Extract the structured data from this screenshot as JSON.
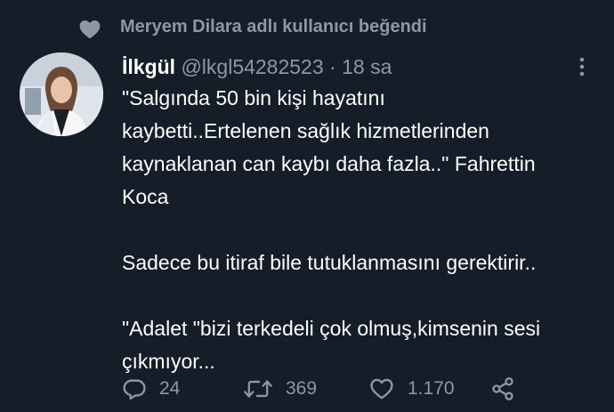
{
  "social_context": {
    "icon": "heart-icon",
    "text": "Meryem Dilara adlı kullanıcı beğendi"
  },
  "tweet": {
    "avatar_icon": "avatar",
    "author_name": "İlkgül",
    "author_handle": "@lkgl54282523",
    "separator": "·",
    "time": "18 sa",
    "menu_icon": "more-vertical-icon",
    "body": {
      "paragraph_1_line_1": "\"Salgında 50 bin kişi hayatını",
      "paragraph_1_line_2": "kaybetti..Ertelenen sağlık hizmetlerinden",
      "paragraph_1_line_3": "kaynaklanan can kaybı daha fazla..\" Fahrettin",
      "paragraph_1_line_4": "Koca",
      "paragraph_2": "Sadece bu itiraf bile tutuklanmasını gerektirir..",
      "paragraph_3_line_1": "\"Adalet \"bizi terkedeli çok olmuş,kimsenin sesi",
      "paragraph_3_line_2": "çıkmıyor..."
    },
    "actions": {
      "reply_count": "24",
      "retweet_count": "369",
      "like_count": "1.170"
    }
  },
  "colors": {
    "background": "#151d28",
    "text_primary": "#ffffff",
    "text_secondary": "#8b98a5"
  }
}
